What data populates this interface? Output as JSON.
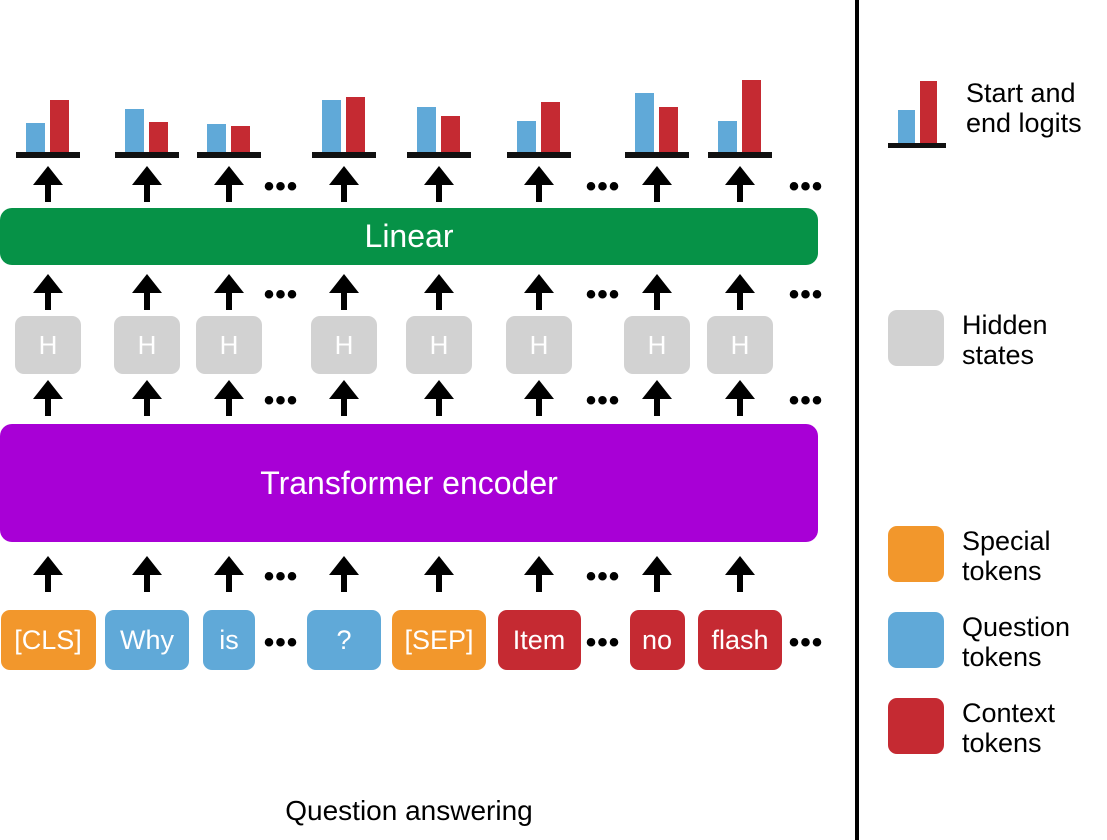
{
  "title": "Question answering",
  "colors": {
    "special": "#F2972C",
    "question": "#60A9D8",
    "context": "#C52A32",
    "hidden": "#D2D2D2",
    "linear": "#069247",
    "encoder": "#A800D6",
    "axis": "#111111"
  },
  "layers": {
    "linear_label": "Linear",
    "encoder_label": "Transformer encoder",
    "hidden_state_label": "H"
  },
  "ellipsis": "•••",
  "columns": [
    {
      "token": "[CLS]",
      "type": "special",
      "hidden": "H"
    },
    {
      "token": "Why",
      "type": "question",
      "hidden": "H"
    },
    {
      "token": "is",
      "type": "question",
      "hidden": "H"
    },
    {
      "token": "?",
      "type": "question",
      "hidden": "H"
    },
    {
      "token": "[SEP]",
      "type": "special",
      "hidden": "H"
    },
    {
      "token": "Item",
      "type": "context",
      "hidden": "H"
    },
    {
      "token": "no",
      "type": "context",
      "hidden": "H"
    },
    {
      "token": "flash",
      "type": "context",
      "hidden": "H"
    }
  ],
  "chart_data": {
    "type": "bar",
    "title": "Start and end logits",
    "categories": [
      "[CLS]",
      "Why",
      "is",
      "?",
      "[SEP]",
      "Item",
      "no",
      "flash"
    ],
    "series": [
      {
        "name": "Start logits",
        "color": "#60A9D8",
        "values": [
          30,
          44,
          29,
          53,
          46,
          32,
          60,
          32
        ]
      },
      {
        "name": "End logits",
        "color": "#C52A32",
        "values": [
          53,
          31,
          27,
          56,
          37,
          51,
          46,
          73
        ]
      }
    ],
    "ylim": [
      0,
      80
    ],
    "xlabel": "",
    "ylabel": "",
    "grid": false,
    "legend": "right"
  },
  "legend": {
    "items": [
      {
        "name": "logits",
        "swatch": "bar-chart-icon",
        "label": "Start and\nend logits"
      },
      {
        "name": "hidden",
        "swatch": "gray-square",
        "label": "Hidden\nstates"
      },
      {
        "name": "special",
        "swatch": "orange-square",
        "label": "Special\ntokens"
      },
      {
        "name": "question",
        "swatch": "blue-square",
        "label": "Question\ntokens"
      },
      {
        "name": "context",
        "swatch": "red-square",
        "label": "Context\ntokens"
      }
    ]
  }
}
